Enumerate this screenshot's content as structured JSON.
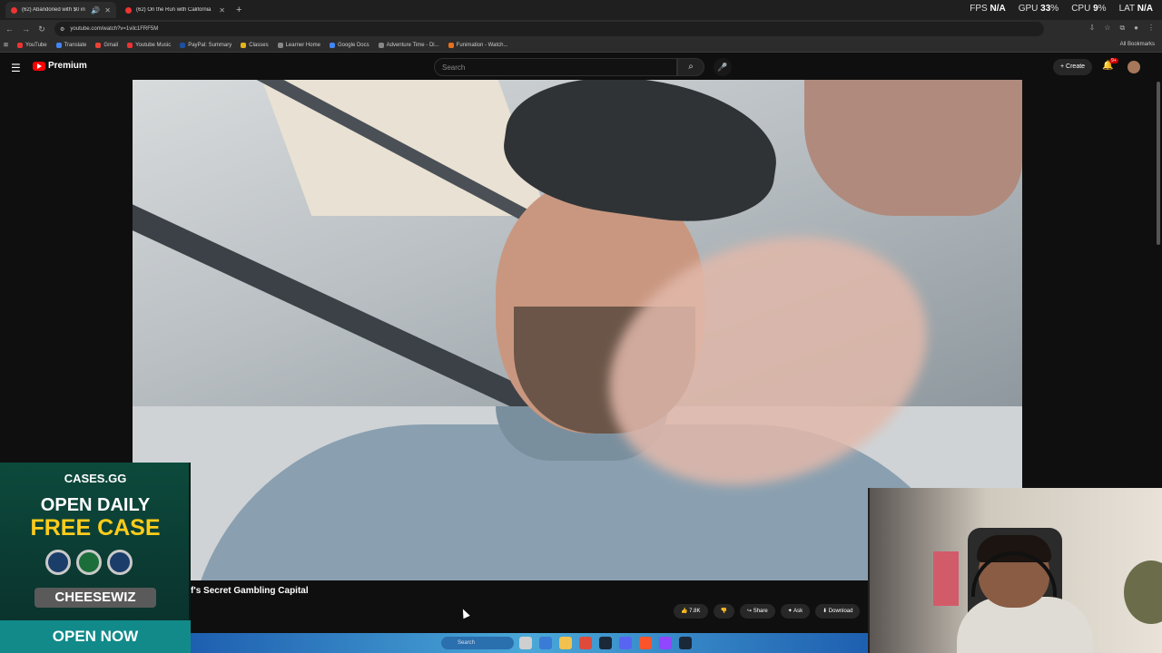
{
  "browser": {
    "tabs": [
      {
        "title": "(62) Abandoned with $0 in"
      },
      {
        "title": "(62) On the Run with California"
      }
    ],
    "url": "youtube.com/watch?v=1vilc1FRF5M",
    "perf": {
      "fps_label": "FPS",
      "fps": "N/A",
      "gpu_label": "GPU",
      "gpu": "33",
      "cpu_label": "CPU",
      "cpu": "9",
      "lat_label": "LAT",
      "lat": "N/A",
      "percent": "%"
    },
    "bookmarks": [
      "YouTube",
      "Translate",
      "Gmail",
      "Youtube Music",
      "PayPal: Summary",
      "Classes",
      "Learner Home",
      "Google Docs",
      "Adventure Time - Di...",
      "Funimation - Watch..."
    ],
    "all_bookmarks": "All Bookmarks"
  },
  "youtube": {
    "brand": "Premium",
    "search_placeholder": "Search",
    "create": "Create",
    "notif_count": "9+",
    "video_title": "f's Secret Gambling Capital",
    "actions": {
      "likes": "7.8K",
      "share": "Share",
      "ask": "Ask",
      "download": "Download"
    }
  },
  "taskbar": {
    "search": "Search"
  },
  "ad": {
    "logo": "CASES.GG",
    "line1": "OPEN DAILY",
    "line2": "FREE CASE",
    "code": "CHEESEWIZ",
    "cta": "OPEN NOW"
  },
  "colors": {
    "brand_red": "#ff0000",
    "ad_yellow": "#ffcc1a",
    "ad_teal": "#128a8a"
  }
}
